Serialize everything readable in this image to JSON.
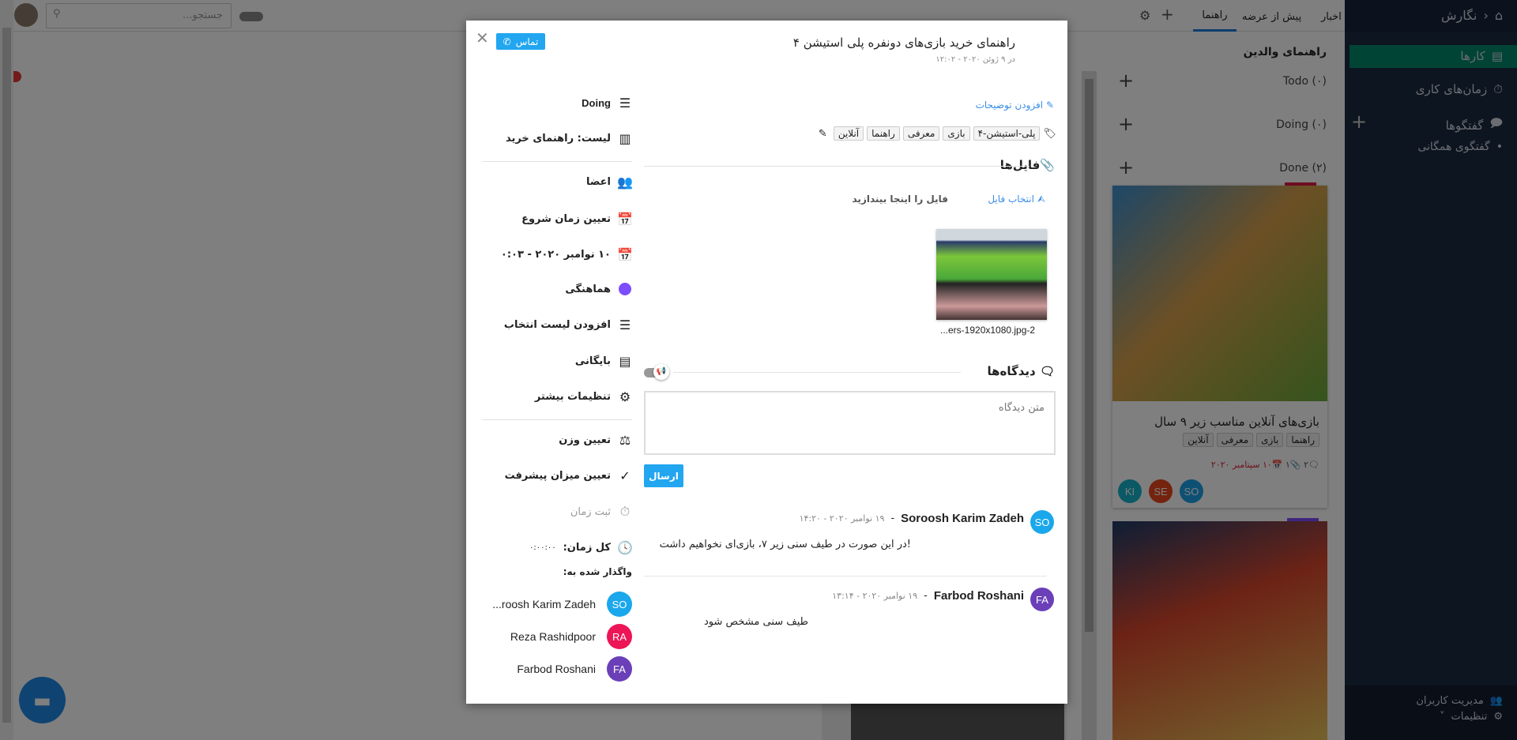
{
  "topbar": {
    "search_placeholder": "جستجو...",
    "tabs": [
      "اخبار",
      "پیش از عرضه",
      "راهنما"
    ],
    "active_tab": "راهنما"
  },
  "sidebar": {
    "breadcrumb": "نگارش",
    "items": [
      {
        "label": "کارها",
        "active": true
      },
      {
        "label": "زمان‌های کاری"
      },
      {
        "label": "گفتگوها"
      },
      {
        "label": "گفتگوی همگانی"
      }
    ],
    "footer": [
      "مدیریت کاربران",
      "تنظیمات"
    ],
    "accent": "#00896b"
  },
  "board": {
    "title": "راهنمای والدین",
    "lists": [
      {
        "label": "Todo (۰)"
      },
      {
        "label": "Doing (۰)"
      },
      {
        "label": "Done (۲)"
      }
    ],
    "card": {
      "title": "بازی‌های آنلاین مناسب زیر ۹ سال",
      "tags": [
        "راهنما",
        "بازی",
        "معرفی",
        "آنلاین"
      ],
      "comments": "۲",
      "attachments": "۱",
      "due": "۱۰ سپتامبر ۲۰۲۰",
      "members": [
        {
          "initials": "KI",
          "color": "#17b2c8"
        },
        {
          "initials": "SE",
          "color": "#e8471c"
        },
        {
          "initials": "SO",
          "color": "#1aa0e8"
        }
      ]
    }
  },
  "modal": {
    "title": "راهنمای خرید بازی‌های دونفره پلی استیشن ۴",
    "date": "در ۹ ژوئن ۲۰۲۰ - ۱۲:۰۲",
    "contact_label": "تماس",
    "add_description": "افزودن توضیحات",
    "tags": [
      "پلی-استیشن-۴",
      "بازی",
      "معرفی",
      "راهنما",
      "آنلاین"
    ],
    "files_heading": "فایل‌ها",
    "choose_file": "انتخاب فایل",
    "drop_hint": "فایل را اینجا بیندازید",
    "file_name": "...ers-1920x1080.jpg-2",
    "comments_heading": "دیدگاه‌ها",
    "comment_placeholder": "متن دیدگاه",
    "send_label": "ارسال",
    "comments": [
      {
        "initials": "SO",
        "color": "#1aa7ec",
        "author": "Soroosh Karim Zadeh",
        "date": "۱۹ نوامبر ۲۰۲۰ - ۱۴:۲۰",
        "text": "!در این صورت در طیف سنی زیر ۷، بازی‌ای نخواهیم داشت"
      },
      {
        "initials": "FA",
        "color": "#6a3fb8",
        "author": "Farbod Roshani",
        "date": "۱۹ نوامبر ۲۰۲۰ - ۱۳:۱۴",
        "text": "طیف سنی مشخص شود"
      }
    ],
    "side": {
      "status": "Doing",
      "list": "لیست: راهنمای خرید",
      "members": "اعضا",
      "start": "تعیین زمان شروع",
      "due": "۱۰ نوامبر ۲۰۲۰ - ۰:۰۳",
      "label": "هماهنگی",
      "label_color": "#7c4dff",
      "checklist": "افزودن لیست انتخاب",
      "archive": "بایگانی",
      "more": "تنظیمات بیشتر",
      "weight": "تعیین وزن",
      "progress": "تعیین میزان پیشرفت",
      "log_time": "ثبت زمان",
      "total_label": "کل زمان:",
      "total_value": "۰:۰۰:۰۰",
      "assigned_label": "واگذار شده به:",
      "assignees": [
        {
          "initials": "SO",
          "color": "#1aa7ec",
          "name": "...roosh Karim Zadeh"
        },
        {
          "initials": "RA",
          "color": "#ec1556",
          "name": "Reza Rashidpoor"
        },
        {
          "initials": "FA",
          "color": "#6a3fb8",
          "name": "Farbod Roshani"
        }
      ]
    }
  }
}
